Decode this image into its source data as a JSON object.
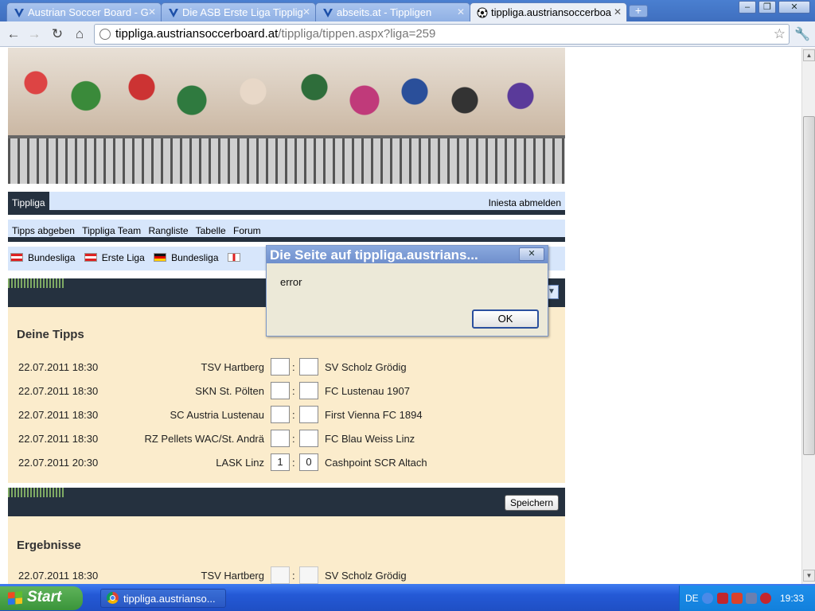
{
  "browser": {
    "tabs": [
      {
        "title": "Austrian Soccer Board - G",
        "active": false
      },
      {
        "title": "Die ASB Erste Liga Tipplig",
        "active": false
      },
      {
        "title": "abseits.at - Tippligen",
        "active": false
      },
      {
        "title": "tippliga.austriansoccerboa",
        "active": true
      }
    ],
    "url_host": "tippliga.austriansoccerboard.at",
    "url_path": "/tippliga/tippen.aspx?liga=259"
  },
  "site": {
    "nav1": {
      "tippliga_tab": "Tippliga",
      "logout": "Iniesta abmelden"
    },
    "nav2": [
      "Tipps abgeben",
      "Tippliga Team",
      "Rangliste",
      "Tabelle",
      "Forum"
    ],
    "leagues": [
      {
        "name": "Bundesliga",
        "flag": "austria"
      },
      {
        "name": "Erste Liga",
        "flag": "austria"
      },
      {
        "name": "Bundesliga",
        "flag": "germany"
      },
      {
        "name": "",
        "flag": "england"
      }
    ]
  },
  "tipps": {
    "title": "Deine Tipps",
    "rows": [
      {
        "date": "22.07.2011 18:30",
        "home": "TSV Hartberg",
        "home_goals": "",
        "away_goals": "",
        "away": "SV Scholz Grödig"
      },
      {
        "date": "22.07.2011 18:30",
        "home": "SKN St. Pölten",
        "home_goals": "",
        "away_goals": "",
        "away": "FC Lustenau 1907"
      },
      {
        "date": "22.07.2011 18:30",
        "home": "SC Austria Lustenau",
        "home_goals": "",
        "away_goals": "",
        "away": "First Vienna FC 1894"
      },
      {
        "date": "22.07.2011 18:30",
        "home": "RZ Pellets WAC/St. Andrä",
        "home_goals": "",
        "away_goals": "",
        "away": "FC Blau Weiss Linz"
      },
      {
        "date": "22.07.2011 20:30",
        "home": "LASK Linz",
        "home_goals": "1",
        "away_goals": "0",
        "away": "Cashpoint SCR Altach"
      }
    ],
    "save_label": "Speichern"
  },
  "results": {
    "title": "Ergebnisse",
    "rows": [
      {
        "date": "22.07.2011 18:30",
        "home": "TSV Hartberg",
        "home_goals": "",
        "away_goals": "",
        "away": "SV Scholz Grödig"
      }
    ]
  },
  "dialog": {
    "title": "Die Seite auf tippliga.austrians...",
    "message": "error",
    "ok_label": "OK"
  },
  "taskbar": {
    "start_label": "Start",
    "window_label": "tippliga.austrianso...",
    "language": "DE",
    "clock": "19:33"
  }
}
